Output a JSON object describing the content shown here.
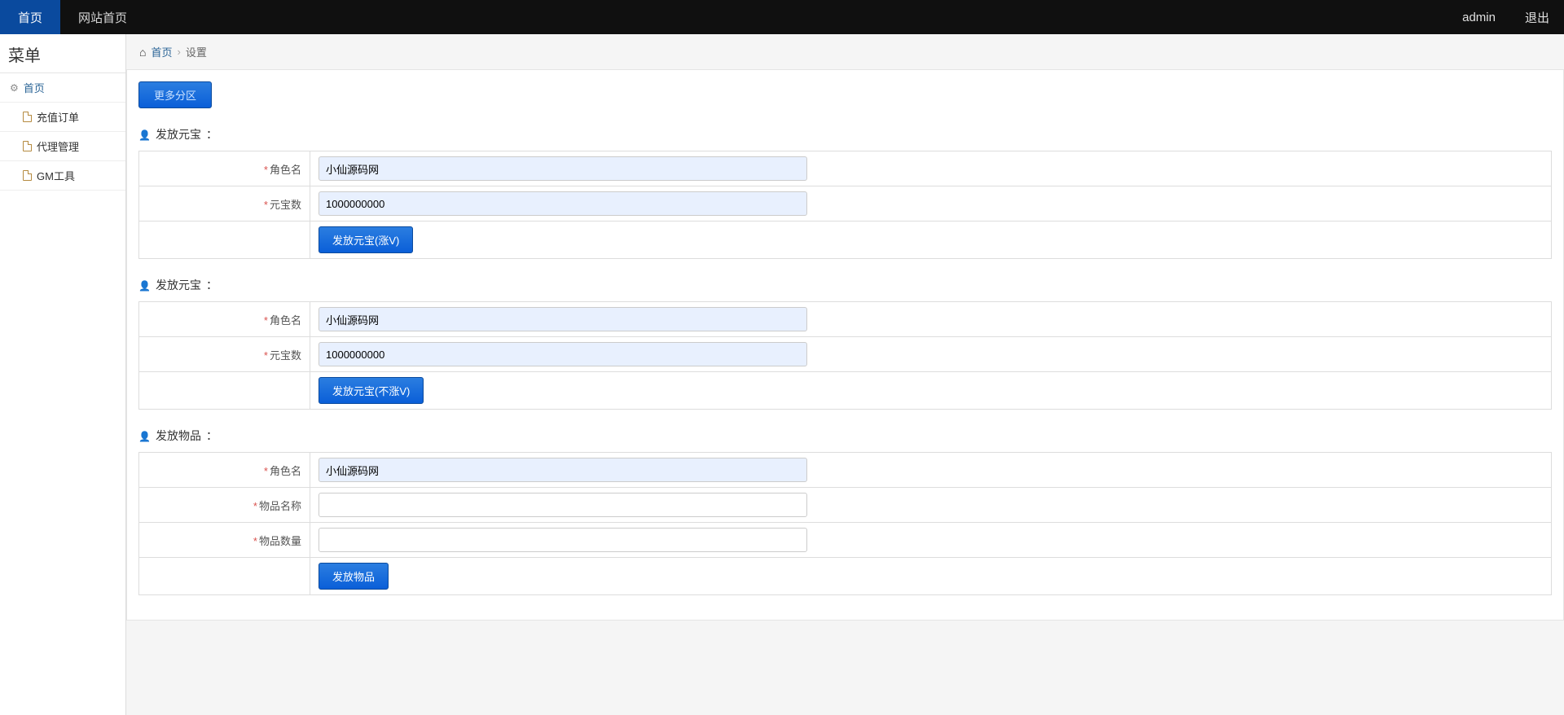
{
  "navbar": {
    "left": [
      {
        "label": "首页",
        "active": true
      },
      {
        "label": "网站首页",
        "active": false
      }
    ],
    "right": {
      "user": "admin",
      "logout": "退出"
    }
  },
  "sidebar": {
    "title": "菜单",
    "items": [
      {
        "label": "首页",
        "icon": "gear",
        "level": 1
      },
      {
        "label": "充值订单",
        "icon": "file",
        "level": 2
      },
      {
        "label": "代理管理",
        "icon": "file",
        "level": 2
      },
      {
        "label": "GM工具",
        "icon": "file",
        "level": 2
      }
    ]
  },
  "breadcrumb": {
    "home": "首页",
    "current": "设置"
  },
  "region_button": "更多分区",
  "sections": {
    "s1": {
      "title": "发放元宝",
      "fields": {
        "role_label": "角色名",
        "role_value": "小仙源码网",
        "amount_label": "元宝数",
        "amount_value": "1000000000"
      },
      "submit": "发放元宝(涨V)"
    },
    "s2": {
      "title": "发放元宝",
      "fields": {
        "role_label": "角色名",
        "role_value": "小仙源码网",
        "amount_label": "元宝数",
        "amount_value": "1000000000"
      },
      "submit": "发放元宝(不涨V)"
    },
    "s3": {
      "title": "发放物品",
      "fields": {
        "role_label": "角色名",
        "role_value": "小仙源码网",
        "item_name_label": "物品名称",
        "item_name_value": "",
        "item_qty_label": "物品数量",
        "item_qty_value": ""
      },
      "submit": "发放物品"
    }
  }
}
